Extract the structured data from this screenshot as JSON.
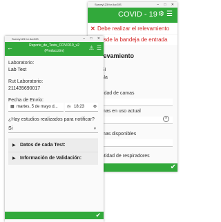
{
  "back_window": {
    "titlebar": "Survey123 for ArcGIS",
    "title": "COVID - 19",
    "banner1": "Debe realizar el relevamiento",
    "banner2": "desde la bandeja de entrada",
    "section": "levamiento",
    "values": [
      "Si",
      "Na"
    ],
    "fields": [
      "tidad de camas",
      "mas en uso actual",
      "mas disponibles",
      "ntidad de respiradores"
    ]
  },
  "front_window": {
    "titlebar": "Survey123 for ArcGIS",
    "title_line1": "Reporte_de_Tests_COVID19_v2",
    "title_line2": "(Producción)",
    "laboratorio_label": "Laboratorio:",
    "laboratorio_value": "Lab Test",
    "rut_label": "Rut Laboratorio:",
    "rut_value": "211435690017",
    "fecha_label": "Fecha de Envío:",
    "fecha_date": "martes, 5 de mayo d...",
    "fecha_time": "18:23",
    "estudios_label": "¿Hay estudios realizados para notificar?",
    "estudios_value": "Si",
    "group1": "Datos de cada Test:",
    "group2": "Información de Validación:"
  },
  "colors": {
    "header_green": "#32a93b",
    "alert_red": "#d22020"
  }
}
